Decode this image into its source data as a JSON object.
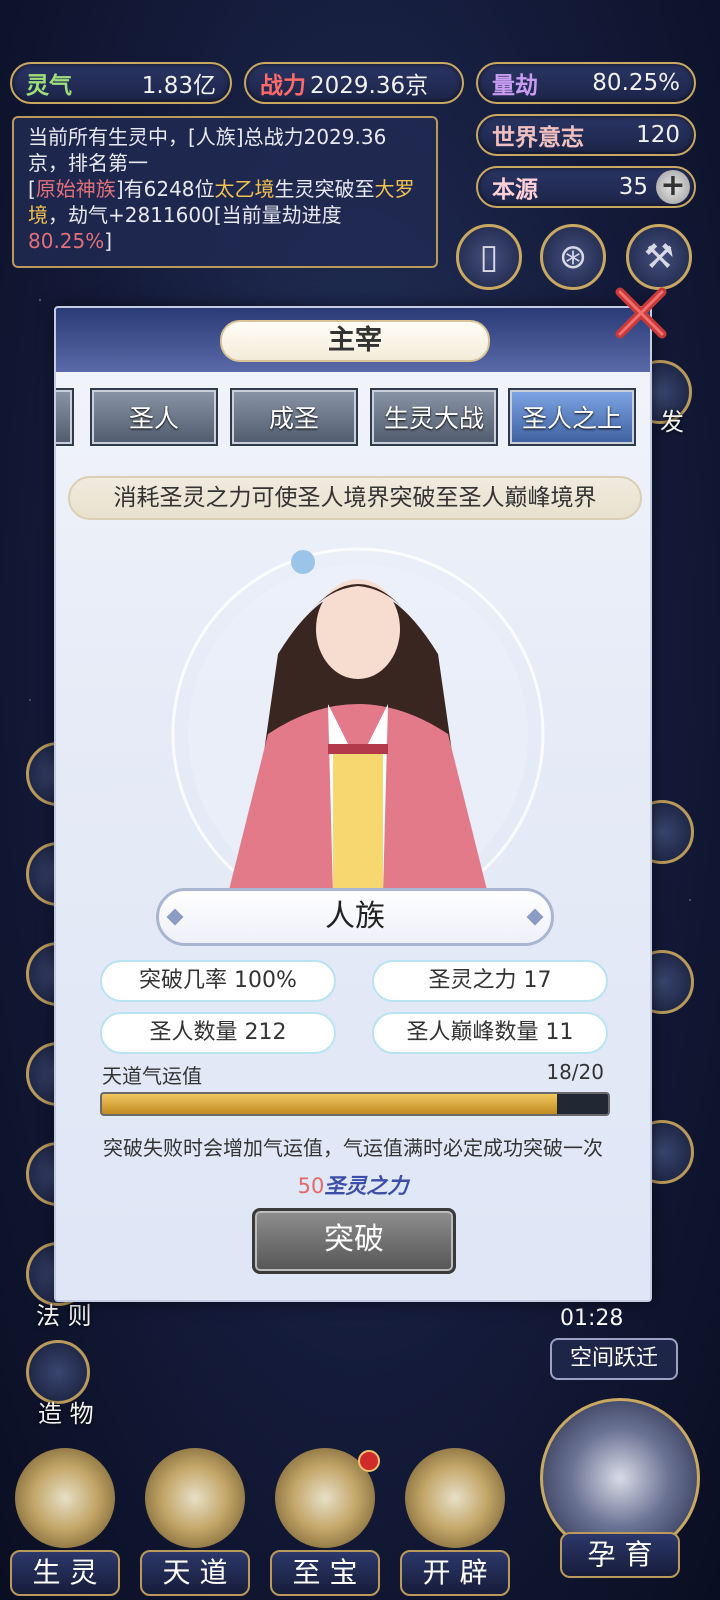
{
  "resources": {
    "lingqi": {
      "label": "灵气",
      "value": "1.83亿"
    },
    "zhanli": {
      "label": "战力",
      "value": "2029.36京"
    },
    "liangjie": {
      "label": "量劫",
      "value": "80.25%"
    },
    "shijie": {
      "label": "世界意志",
      "value": "120"
    },
    "benyuan": {
      "label": "本源",
      "value": "35"
    }
  },
  "messages": {
    "line1": "当前所有生灵中，[人族]总战力2029.36京，排名第一",
    "line2_a": "[",
    "line2_race": "原始神族",
    "line2_b": "]有6248位",
    "line2_realm": "太乙境",
    "line2_c": "生灵突破至",
    "line2_realm2": "大罗境",
    "line2_d": "，劫气+2811600[当前量劫进度",
    "line2_pct": "80.25%",
    "line2_e": "]"
  },
  "side": {
    "left_labels": [
      "法 则",
      "造 物"
    ],
    "right_partial": "发",
    "timer": "01:28",
    "space": "空间跃迁"
  },
  "modal": {
    "title": "主宰",
    "tabs": [
      "圣人",
      "成圣",
      "生灵大战",
      "圣人之上"
    ],
    "active_tab": "圣人之上",
    "description": "消耗圣灵之力可使圣人境界突破至圣人巅峰境界",
    "race": "人族",
    "stats": {
      "rate": "突破几率 100%",
      "power": "圣灵之力 17",
      "saints": "圣人数量 212",
      "peak": "圣人巅峰数量 11"
    },
    "fortune": {
      "label": "天道气运值",
      "value": "18/20",
      "fraction": 0.9
    },
    "note": "突破失败时会增加气运值，气运值满时必定成功突破一次",
    "cost": {
      "num": "50",
      "unit": "圣灵之力"
    },
    "break_label": "突破"
  },
  "nav": {
    "items": [
      "生 灵",
      "天 道",
      "至 宝",
      "开 辟"
    ],
    "main": "孕 育"
  },
  "colors": {
    "gold": "#c9a862",
    "accent_blue": "#3d5f9e",
    "bar_fill": "#d8a63a"
  }
}
